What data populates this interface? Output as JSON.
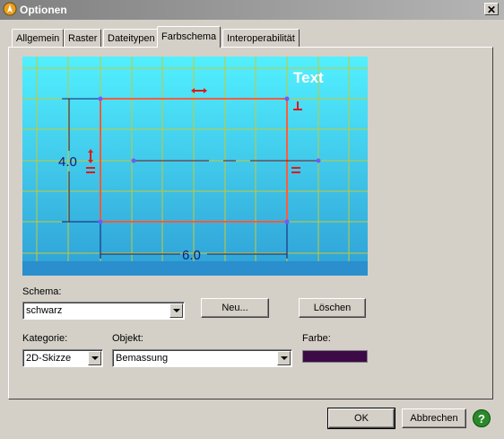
{
  "window": {
    "title": "Optionen",
    "close_glyph": "✕"
  },
  "tabs": [
    {
      "label": "Allgemein",
      "active": false
    },
    {
      "label": "Raster",
      "active": false
    },
    {
      "label": "Dateitypen",
      "active": false
    },
    {
      "label": "Farbschema",
      "active": true
    },
    {
      "label": "Interoperabilität",
      "active": false
    }
  ],
  "preview": {
    "text_label": "Text",
    "dim_vertical": "4.0",
    "dim_horizontal": "6.0",
    "colors": {
      "bg_top": "#52f0ff",
      "bg_bottom": "#2ea0d6",
      "grid": "#c8c832",
      "geometry": "#ff5c3c",
      "dimension": "#1a1a6e",
      "constraint": "#e01818",
      "point": "#6a5cff"
    }
  },
  "schema": {
    "label": "Schema:",
    "value": "schwarz"
  },
  "buttons": {
    "new": "Neu...",
    "delete": "Löschen",
    "ok": "OK",
    "cancel": "Abbrechen",
    "help": "?"
  },
  "kategorie": {
    "label": "Kategorie:",
    "value": "2D-Skizze"
  },
  "objekt": {
    "label": "Objekt:",
    "value": "Bemassung"
  },
  "farbe": {
    "label": "Farbe:",
    "color": "#3c0a46"
  }
}
